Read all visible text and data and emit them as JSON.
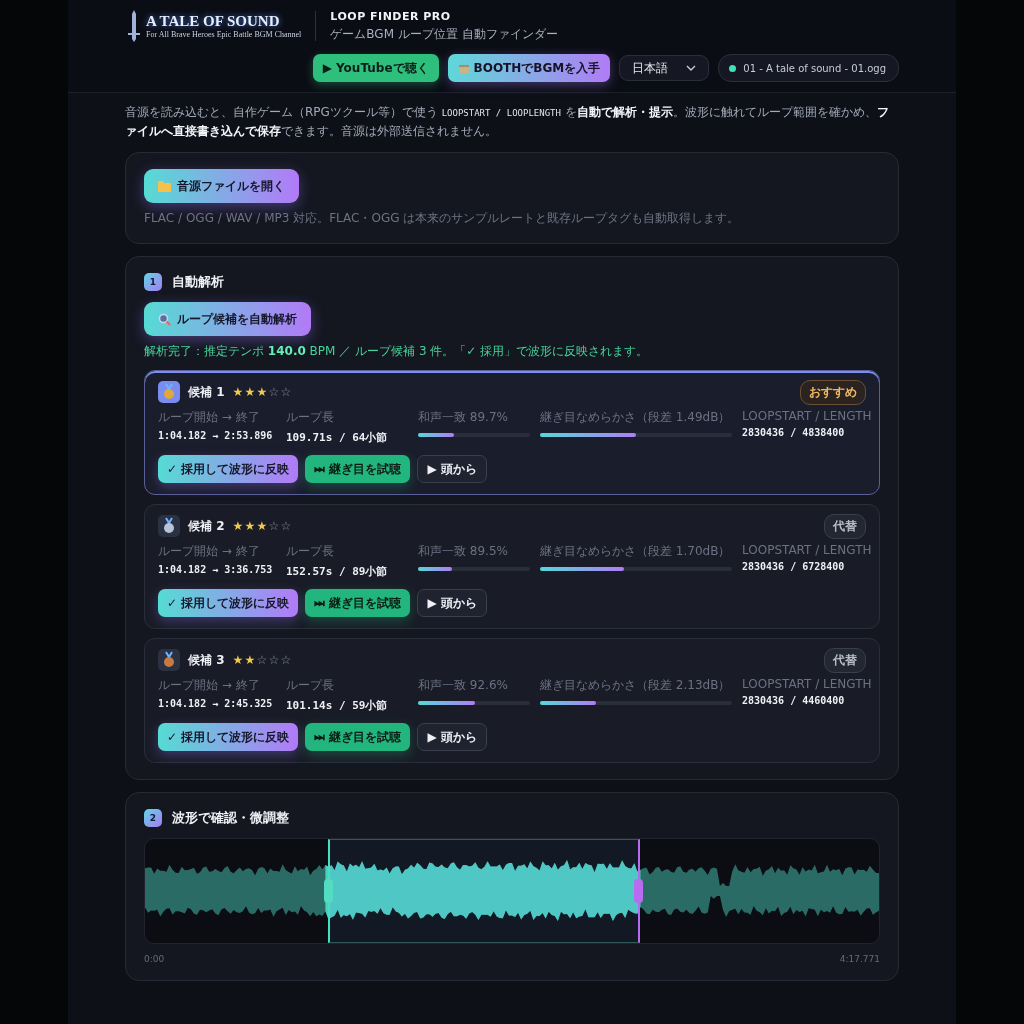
{
  "header": {
    "logo_title": "A TALE OF SOUND",
    "logo_subtitle": "For All Brave Heroes  Epic Battle BGM Channel",
    "app_title": "LOOP FINDER PRO",
    "app_subtitle": "ゲームBGM ループ位置 自動ファインダー",
    "buttons": [
      {
        "kind": "youtube",
        "label": "▶ YouTubeで聴く"
      },
      {
        "kind": "booth",
        "label": "BOOTHでBGMを入手"
      }
    ],
    "language": "日本語",
    "file": {
      "name": "01 - A tale of sound - 01.ogg",
      "loaded": true
    }
  },
  "intro": {
    "before": "音源を読み込むと、自作ゲーム（RPGツクール等）で使う",
    "code": "LOOPSTART / LOOPLENGTH",
    "after": "を**自動で解析・提示**。波形に触れてループ範囲を確かめ、**ファイルへ直接書き込んで保存**できます。音源は外部送信されません。"
  },
  "open_card": {
    "button": "音源ファイルを開く",
    "note": "FLAC / OGG / WAV / MP3 対応。FLAC・OGG は本来のサンプルレートと既存ループタグも自動取得します。"
  },
  "analysis": {
    "step": "1",
    "title": "自動解析",
    "button": "ループ候補を自動解析",
    "status": "解析完了：推定テンポ **140.0** BPM ／ ループ候補 3 件。「✓ 採用」で波形に反映されます。",
    "candidates": [
      {
        "title": "候補 1",
        "stars": 3,
        "selected": true,
        "color": "#e0a83a",
        "tag": {
          "kind": "recommended",
          "label": "おすすめ"
        },
        "range_label": "ループ開始 → 終了",
        "range": "1:04.182 → 2:53.896",
        "length_label": "ループ長",
        "length": "109.71s / 64小節",
        "harmony": {
          "label": "和声一致 89.7%",
          "level": 0.32
        },
        "smoothness": {
          "label": "継ぎ目なめらかさ（段差 1.49dB）",
          "level": 0.5
        },
        "tags_label": "LOOPSTART / LENGTH",
        "tags": "2830436 / 4838400",
        "actions": [
          "✓ 採用して波形に反映",
          "⏭ 継ぎ目を試聴",
          "▶ 頭から"
        ]
      },
      {
        "title": "候補 2",
        "stars": 3,
        "selected": false,
        "color": "#b8c2d8",
        "tag": {
          "kind": "alternative",
          "label": "代替"
        },
        "range_label": "ループ開始 → 終了",
        "range": "1:04.182 → 3:36.753",
        "length_label": "ループ長",
        "length": "152.57s / 89小節",
        "harmony": {
          "label": "和声一致 89.5%",
          "level": 0.3
        },
        "smoothness": {
          "label": "継ぎ目なめらかさ（段差 1.70dB）",
          "level": 0.44
        },
        "tags_label": "LOOPSTART / LENGTH",
        "tags": "2830436 / 6728400",
        "actions": [
          "✓ 採用して波形に反映",
          "⏭ 継ぎ目を試聴",
          "▶ 頭から"
        ]
      },
      {
        "title": "候補 3",
        "stars": 2,
        "selected": false,
        "color": "#c87a45",
        "tag": {
          "kind": "alternative",
          "label": "代替"
        },
        "range_label": "ループ開始 → 終了",
        "range": "1:04.182 → 2:45.325",
        "length_label": "ループ長",
        "length": "101.14s / 59小節",
        "harmony": {
          "label": "和声一致 92.6%",
          "level": 0.51
        },
        "smoothness": {
          "label": "継ぎ目なめらかさ（段差 2.13dB）",
          "level": 0.29
        },
        "tags_label": "LOOPSTART / LENGTH",
        "tags": "2830436 / 4460400",
        "actions": [
          "✓ 採用して波形に反映",
          "⏭ 継ぎ目を試聴",
          "▶ 頭から"
        ]
      }
    ]
  },
  "waveform": {
    "step": "2",
    "title": "波形で確認・微調整",
    "loop_start": {
      "level": 0.249
    },
    "loop_end": {
      "level": 0.674
    },
    "time_start": "0:00",
    "time_end": "4:17.771"
  }
}
